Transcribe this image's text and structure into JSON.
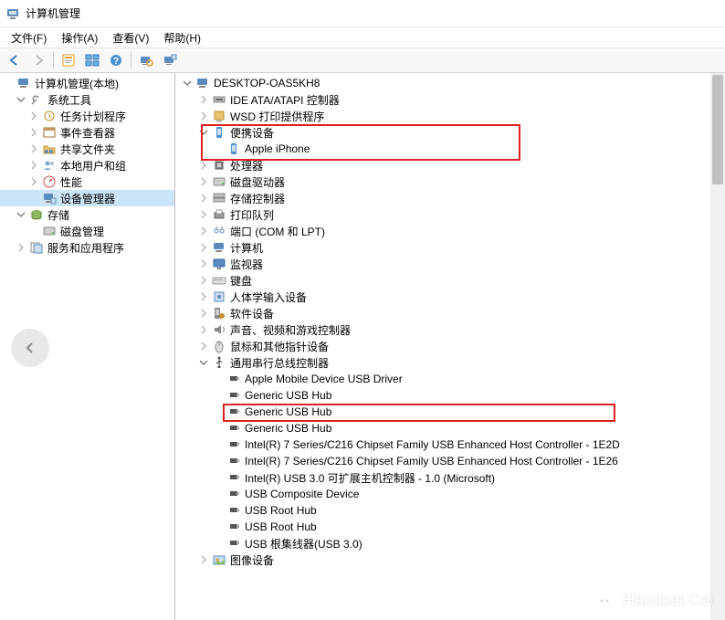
{
  "window": {
    "title": "计算机管理"
  },
  "menu": {
    "file": "文件(F)",
    "action": "操作(A)",
    "view": "查看(V)",
    "help": "帮助(H)"
  },
  "left_tree": {
    "root": "计算机管理(本地)",
    "system_tools": "系统工具",
    "task_scheduler": "任务计划程序",
    "event_viewer": "事件查看器",
    "shared_folders": "共享文件夹",
    "local_users": "本地用户和组",
    "performance": "性能",
    "device_manager": "设备管理器",
    "storage": "存储",
    "disk_mgmt": "磁盘管理",
    "services_apps": "服务和应用程序"
  },
  "right_tree": {
    "root": "DESKTOP-OAS5KH8",
    "ide": "IDE ATA/ATAPI 控制器",
    "wsd": "WSD 打印提供程序",
    "portable": "便携设备",
    "iphone": "Apple iPhone",
    "cpu": "处理器",
    "disk_drives": "磁盘驱动器",
    "storage_ctrl": "存储控制器",
    "print_queue": "打印队列",
    "ports": "端口 (COM 和 LPT)",
    "computer": "计算机",
    "monitor": "监视器",
    "keyboard": "键盘",
    "hid": "人体学输入设备",
    "software_dev": "软件设备",
    "sound": "声音、视频和游戏控制器",
    "mouse": "鼠标和其他指针设备",
    "usb_ctrl": "通用串行总线控制器",
    "usb_items": [
      "Apple Mobile Device USB Driver",
      "Generic USB Hub",
      "Generic USB Hub",
      "Generic USB Hub",
      "Intel(R) 7 Series/C216 Chipset Family USB Enhanced Host Controller - 1E2D",
      "Intel(R) 7 Series/C216 Chipset Family USB Enhanced Host Controller - 1E26",
      "Intel(R) USB 3.0 可扩展主机控制器 - 1.0 (Microsoft)",
      "USB Composite Device",
      "USB Root Hub",
      "USB Root Hub",
      "USB 根集线器(USB 3.0)"
    ],
    "image_dev": "图像设备"
  },
  "watermark": "Handset Cat"
}
